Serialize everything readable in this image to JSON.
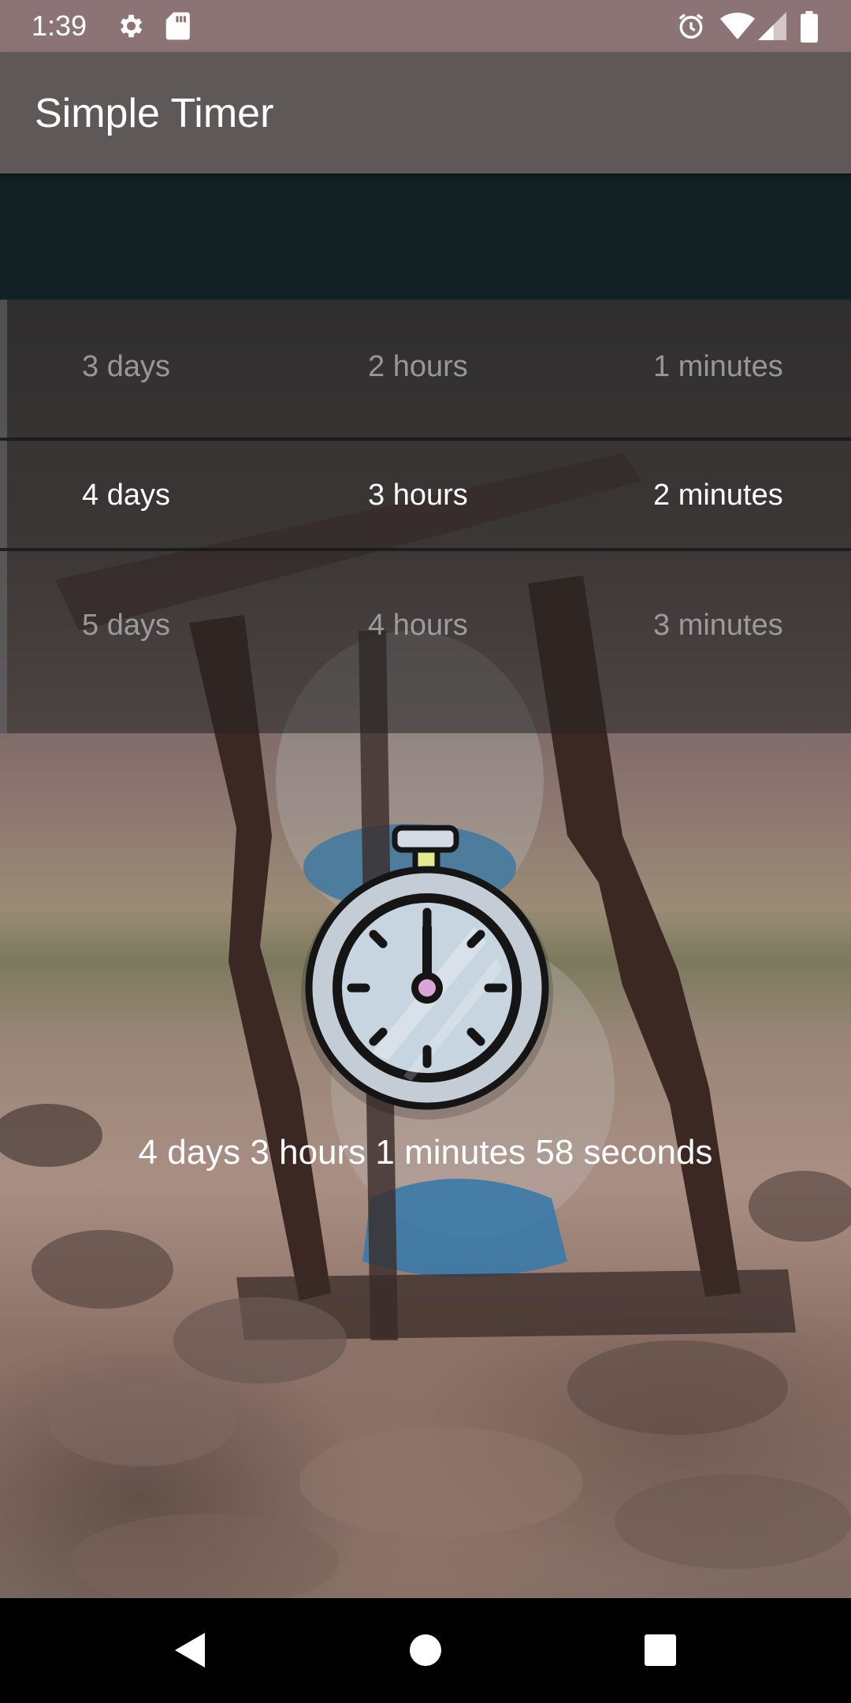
{
  "status_bar": {
    "time": "1:39",
    "icons_left": [
      "settings-icon",
      "sd-card-icon"
    ],
    "icons_right": [
      "alarm-icon",
      "wifi-icon",
      "signal-icon",
      "battery-icon"
    ]
  },
  "app_bar": {
    "title": "Simple Timer"
  },
  "picker": {
    "rows": [
      {
        "days": "3 days",
        "hours": "2 hours",
        "minutes": "1 minutes"
      },
      {
        "days": "4 days",
        "hours": "3 hours",
        "minutes": "2 minutes"
      },
      {
        "days": "5 days",
        "hours": "4 hours",
        "minutes": "3 minutes"
      }
    ],
    "selected_index": 1
  },
  "timer": {
    "icon": "stopwatch-icon",
    "remaining": "4 days 3 hours 1 minutes 58 seconds"
  },
  "nav_bar": {
    "buttons": [
      "back-icon",
      "home-icon",
      "recents-icon"
    ]
  },
  "colors": {
    "status_bar": "#8c7376",
    "app_bar": "#5e5958",
    "dark_band": "#122124",
    "nav_bar": "#000000"
  }
}
